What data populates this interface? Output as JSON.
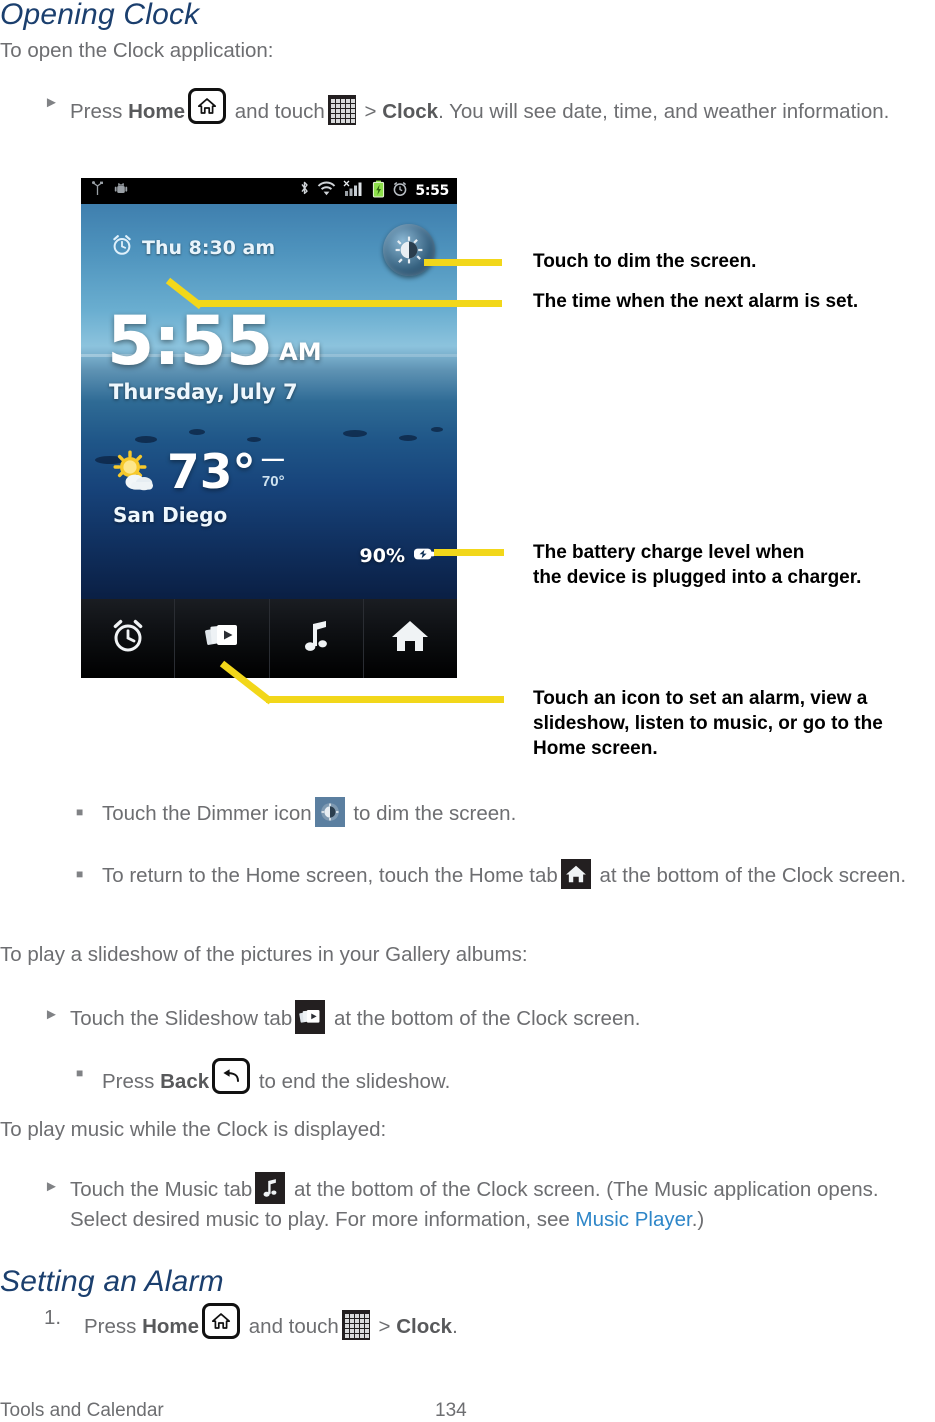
{
  "headings": {
    "opening_clock": "Opening Clock",
    "setting_alarm": "Setting an Alarm"
  },
  "intro": {
    "open_clock": "To open the Clock application:",
    "slideshow_intro": "To play a slideshow of the pictures in your Gallery albums:",
    "music_intro": "To play music while the Clock is displayed:"
  },
  "steps": {
    "press_home_1": "Press",
    "home_label": "Home",
    "and_touch": "and touch",
    "gt": ">",
    "clock_label": "Clock",
    "press_home_tail": ". You will see date, time, and weather information.",
    "press_home_tail_short": "."
  },
  "bullets": {
    "dimmer_pre": "Touch the Dimmer icon",
    "dimmer_post": "to dim the screen.",
    "home_tab_pre": "To return to the Home screen, touch the Home tab",
    "home_tab_post": "at the bottom of the Clock screen.",
    "slideshow_pre": "Touch the Slideshow tab",
    "slideshow_post": "at the bottom of the Clock screen.",
    "back_pre": "Press",
    "back_label": "Back",
    "back_post": "to end the slideshow.",
    "music_pre": "Touch the Music tab",
    "music_post": "at the bottom of the Clock screen. (The Music application opens. Select desired music to play. For more information, see",
    "music_link": "Music Player",
    "music_tail": ".)"
  },
  "numbered": {
    "one": "1."
  },
  "callouts": [
    {
      "id": "dimmer",
      "text": "Touch to dim the screen."
    },
    {
      "id": "next-alarm",
      "text": "The time when the next alarm is set."
    },
    {
      "id": "battery",
      "line1": "The battery charge level when",
      "line2": "the device is plugged into a charger."
    },
    {
      "id": "tabs",
      "line1": "Touch an icon to set an alarm, view a",
      "line2": "slideshow, listen to music, or go to the",
      "line3": "Home screen."
    }
  ],
  "phone": {
    "statusbar": {
      "time": "5:55",
      "icons": [
        "usb-icon",
        "android-debug-icon",
        "bluetooth-icon",
        "wifi-icon",
        "signal-bars-icon",
        "battery-charging-icon",
        "alarm-clock-icon"
      ]
    },
    "next_alarm": "Thu 8:30 am",
    "clock_time": "5:55",
    "clock_ampm": "AM",
    "date": "Thursday, July 7",
    "weather": {
      "temp": "73°",
      "high_dash": "—",
      "low": "70°",
      "city": "San Diego"
    },
    "battery": {
      "percent": "90%"
    },
    "tabs": [
      {
        "name": "alarm-tab",
        "icon": "alarm-clock-icon"
      },
      {
        "name": "slideshow-tab",
        "icon": "slideshow-icon"
      },
      {
        "name": "music-tab",
        "icon": "music-note-icon"
      },
      {
        "name": "home-tab",
        "icon": "house-icon"
      }
    ]
  },
  "footer": {
    "section": "Tools and Calendar",
    "page": "134"
  },
  "colors": {
    "heading": "#1b3f6e",
    "body": "#6d6e71",
    "link": "#2e86c8",
    "callout_line": "#f2d71a",
    "callout_text": "#000000"
  }
}
